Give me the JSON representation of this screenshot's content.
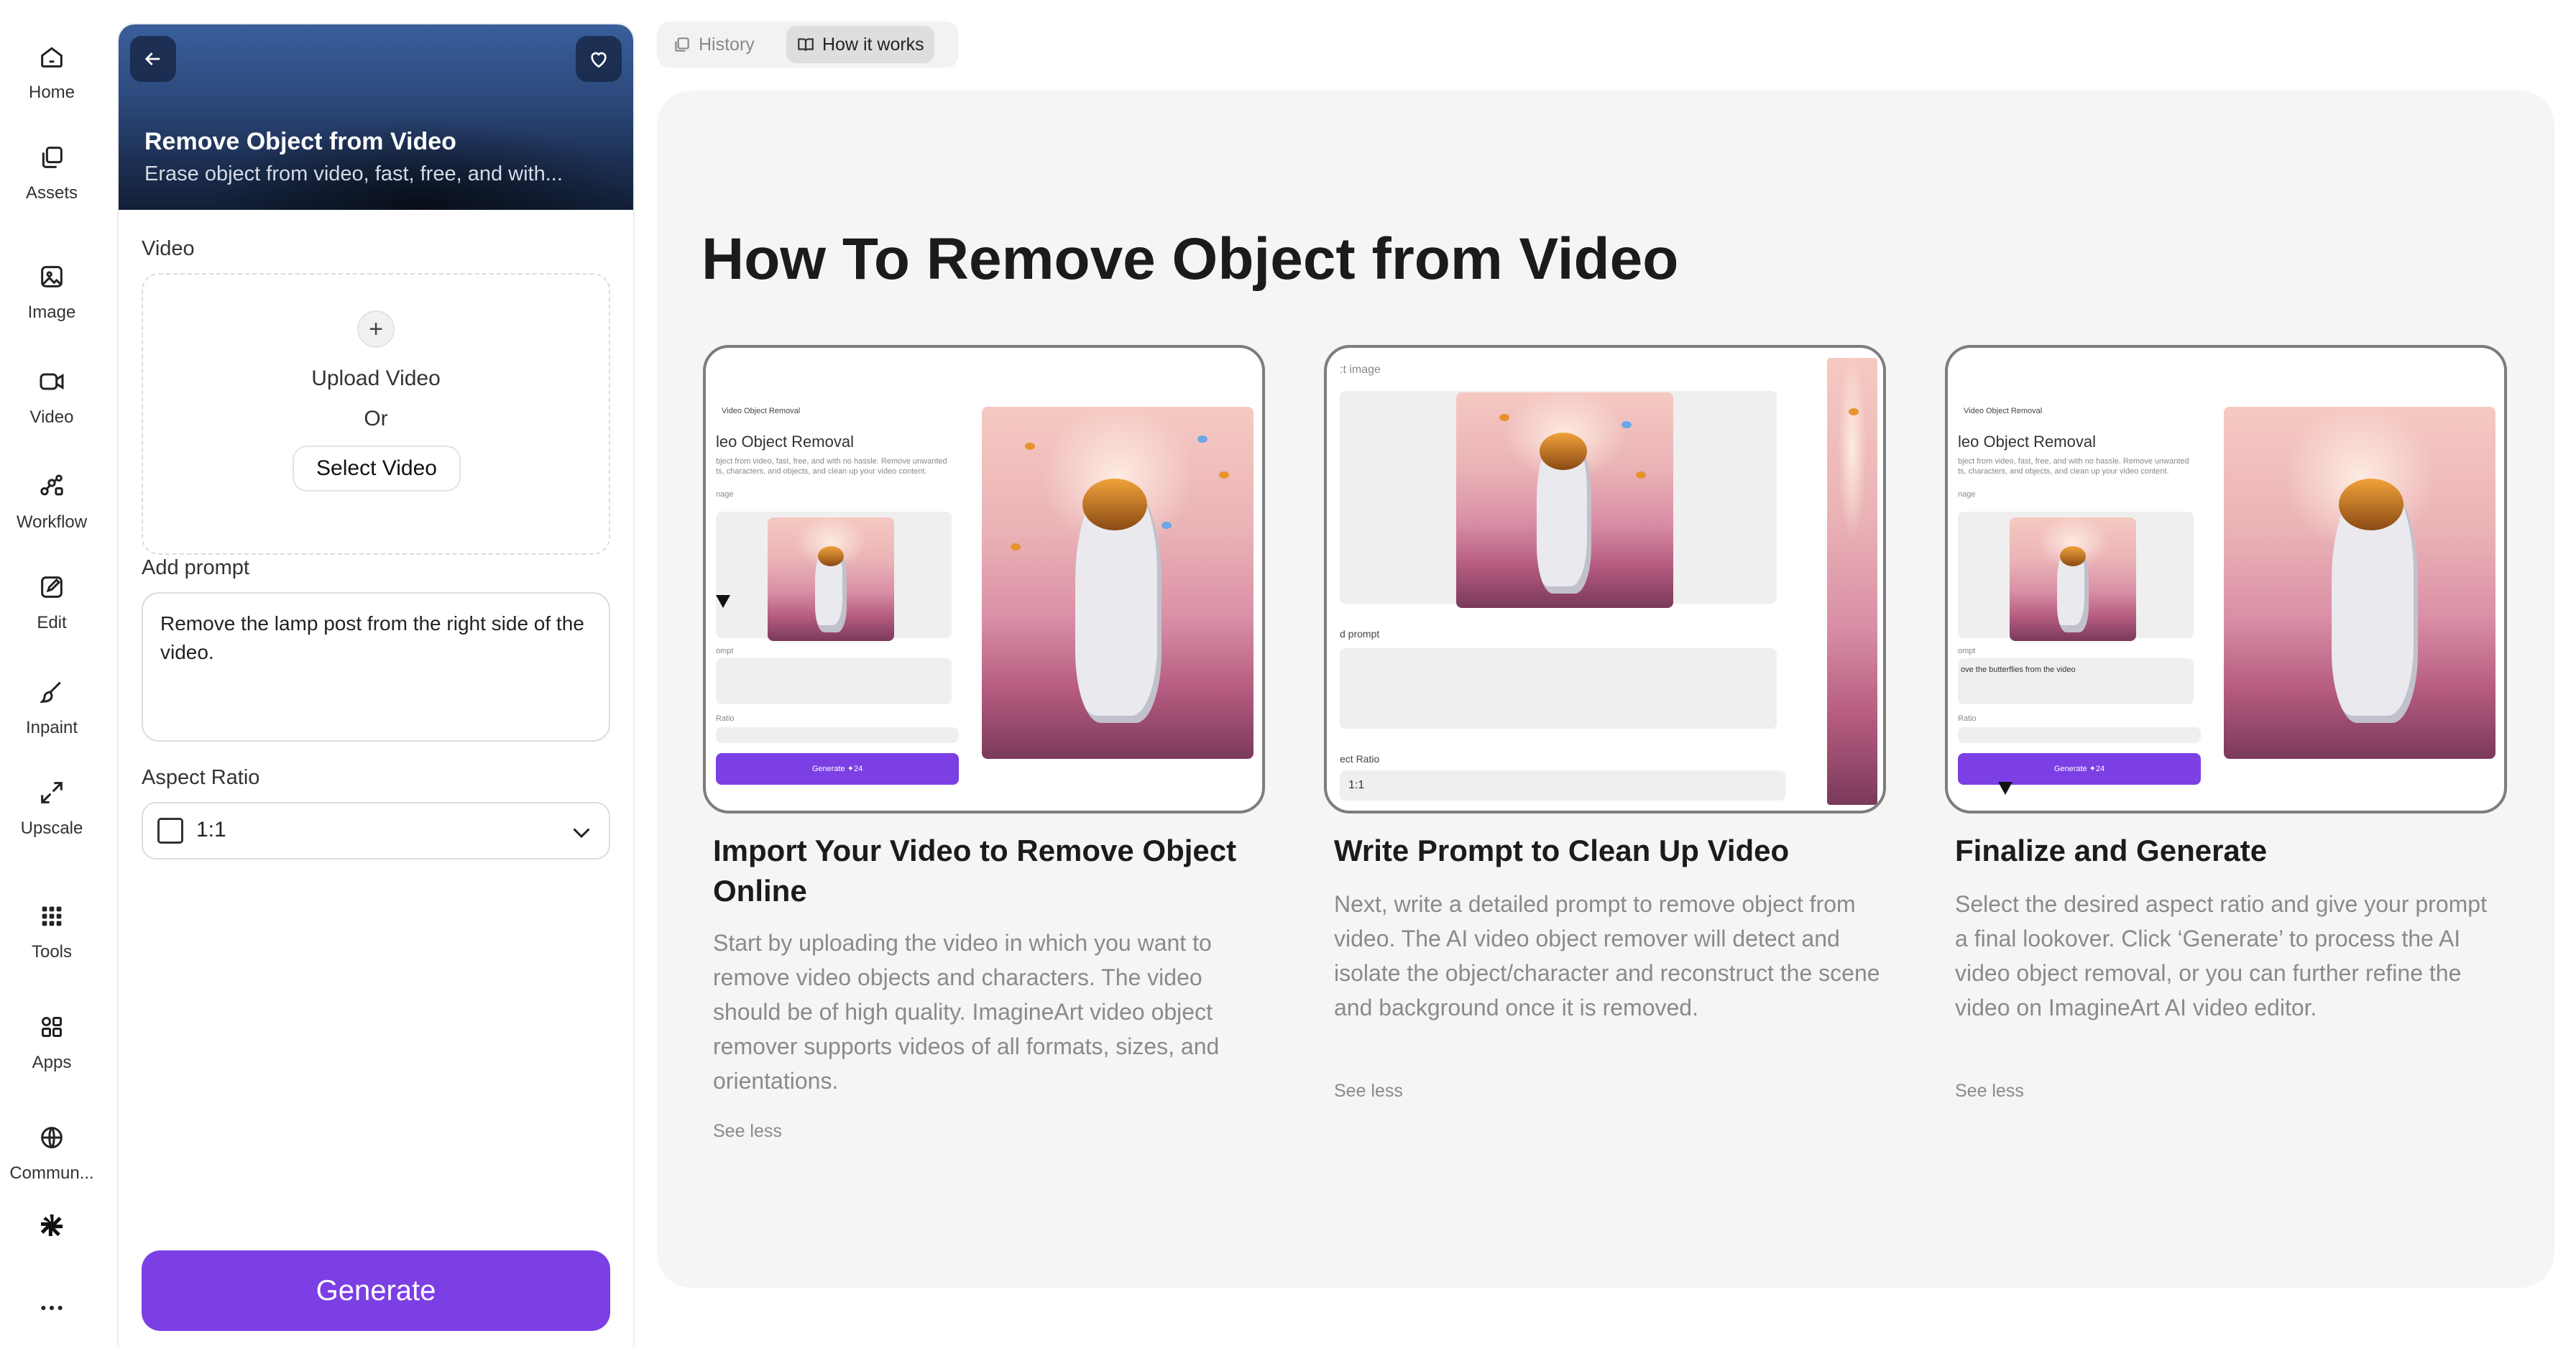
{
  "nav": {
    "items": [
      {
        "label": "Home",
        "icon": "home-icon"
      },
      {
        "label": "Assets",
        "icon": "assets-icon"
      },
      {
        "label": "Image",
        "icon": "image-icon"
      },
      {
        "label": "Video",
        "icon": "video-icon"
      },
      {
        "label": "Workflow",
        "icon": "workflow-icon"
      },
      {
        "label": "Edit",
        "icon": "edit-icon"
      },
      {
        "label": "Inpaint",
        "icon": "brush-icon"
      },
      {
        "label": "Upscale",
        "icon": "expand-icon"
      },
      {
        "label": "Tools",
        "icon": "grid-icon"
      },
      {
        "label": "Apps",
        "icon": "apps-icon"
      },
      {
        "label": "Commun...",
        "icon": "globe-icon"
      }
    ],
    "more_icon": "more-dots-icon",
    "brand_icon": "asterisk-logo-icon"
  },
  "panel": {
    "title": "Remove Object from Video",
    "subtitle": "Erase object from video, fast, free, and with...",
    "video_label": "Video",
    "upload_label": "Upload Video",
    "or_label": "Or",
    "select_label": "Select  Video",
    "prompt_label": "Add prompt",
    "prompt_value": "Remove the lamp post from the right side of the video.",
    "ratio_label": "Aspect Ratio",
    "ratio_value": "1:1",
    "generate_label": "Generate"
  },
  "tabs": [
    {
      "label": "History",
      "active": false
    },
    {
      "label": "How it works",
      "active": true
    }
  ],
  "main": {
    "title": "How To Remove Object from Video",
    "cards": [
      {
        "title": "Import Your Video to Remove Object Online",
        "description": "Start by uploading the video in which you want to remove video objects and characters. The video should be of high quality. ImagineArt video object remover supports videos of all formats, sizes, and orientations.",
        "link": "See less"
      },
      {
        "title": "Write Prompt to Clean Up Video",
        "description": "Next, write a detailed prompt to remove object from video. The AI video object remover will detect and isolate the object/character and reconstruct the scene and background once it is removed.",
        "link": "See less"
      },
      {
        "title": "Finalize and Generate",
        "description": "Select the desired aspect ratio and give your prompt a final lookover. Click ‘Generate’ to process the AI video object removal, or you can further refine the video on ImagineArt AI video editor.",
        "link": "See less"
      }
    ],
    "preview": {
      "app_name": "Video Object Removal",
      "heading_cropped": "leo Object Removal",
      "desc_cropped_1": "bject from video, fast, free, and with no hassle. Remove unwanted",
      "desc_cropped_2": "ts, characters, and objects, and clean up your video content.",
      "image_label_cropped": "nage",
      "prompt_label_cropped": "ompt",
      "ratio_label_cropped": "Ratio",
      "generate_mini": "Generate  ✦24",
      "prompt_mini": "ove the butterflies from the video",
      "zoom_image_label": ":t image",
      "zoom_prompt_label": "d prompt",
      "zoom_ratio_label": "ect Ratio",
      "zoom_ratio_value": "1:1"
    }
  },
  "colors": {
    "accent": "#7b3fe4",
    "main_bg": "#f5f5f5",
    "card_border": "#7d7d7d"
  }
}
